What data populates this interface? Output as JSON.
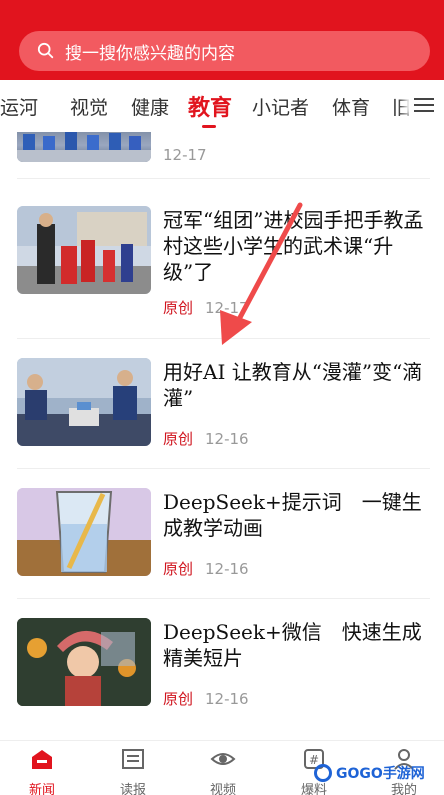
{
  "search": {
    "placeholder": "搜一搜你感兴趣的内容"
  },
  "tabs": [
    {
      "label": "大运河"
    },
    {
      "label": "视觉"
    },
    {
      "label": "健康"
    },
    {
      "label": "教育"
    },
    {
      "label": "小记者"
    },
    {
      "label": "体育"
    },
    {
      "label": "旧"
    }
  ],
  "list": {
    "partial_date": "12-17",
    "items": [
      {
        "title": "冠军“组团”进校园手把手教孟村这些小学生的武术课“升级”了",
        "tag": "原创",
        "date": "12-17"
      },
      {
        "title": " 用好AI 让教育从“漫灌”变“滴灌”",
        "tag": "原创",
        "date": "12-16"
      },
      {
        "title": " DeepSeek+提示词　一键生成教学动画",
        "tag": "原创",
        "date": "12-16"
      },
      {
        "title": "DeepSeek+微信　快速生成精美短片",
        "tag": "原创",
        "date": "12-16"
      }
    ]
  },
  "bottom_nav": [
    {
      "label": "新闻",
      "icon": "news-home-icon"
    },
    {
      "label": "读报",
      "icon": "newspaper-icon"
    },
    {
      "label": "视频",
      "icon": "eye-icon"
    },
    {
      "label": "爆料",
      "icon": "hashtag-icon"
    },
    {
      "label": "我的",
      "icon": "user-icon"
    }
  ],
  "watermark": {
    "text": "GOGO手游网"
  },
  "colors": {
    "brand_red": "#e1141e",
    "tag_red": "#d0141e",
    "meta_gray": "#999999"
  }
}
